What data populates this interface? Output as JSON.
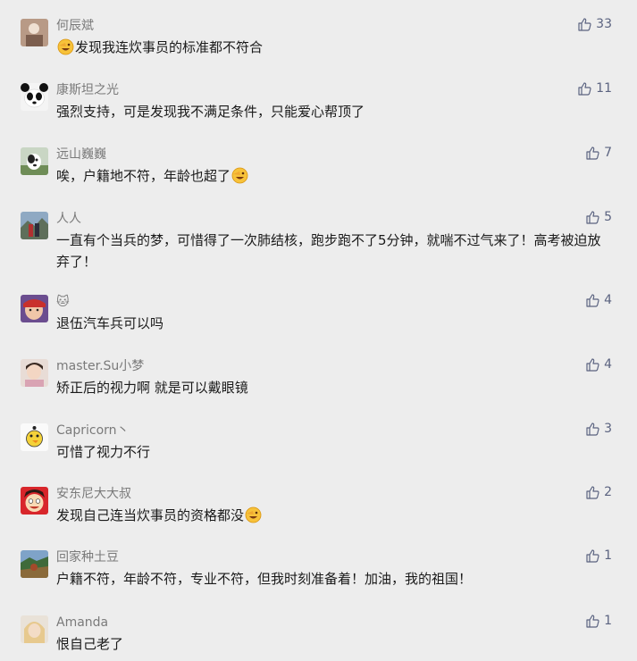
{
  "comments": [
    {
      "name": "何辰斌",
      "text": "发现我连炊事员的标准都不符合",
      "emoji_pos": "start",
      "likes": "33"
    },
    {
      "name": "康斯坦之光",
      "text": "强烈支持，可是发现我不满足条件，只能爱心帮顶了",
      "emoji_pos": "none",
      "likes": "11"
    },
    {
      "name": "远山巍巍",
      "text": "唉，户籍地不符，年龄也超了",
      "emoji_pos": "end",
      "likes": "7"
    },
    {
      "name": "人人",
      "text": "一直有个当兵的梦，可惜得了一次肺结核，跑步跑不了5分钟，就喘不过气来了！高考被迫放弃了！",
      "emoji_pos": "none",
      "likes": "5"
    },
    {
      "name": "🐱",
      "text": "退伍汽车兵可以吗",
      "emoji_pos": "none",
      "likes": "4"
    },
    {
      "name": "master.Su小梦",
      "text": "矫正后的视力啊 就是可以戴眼镜",
      "emoji_pos": "none",
      "likes": "4"
    },
    {
      "name": "Capricorn丶",
      "text": "可惜了视力不行",
      "emoji_pos": "none",
      "likes": "3"
    },
    {
      "name": "安东尼大大叔",
      "text": "发现自己连当炊事员的资格都没",
      "emoji_pos": "end",
      "likes": "2"
    },
    {
      "name": "回家种土豆",
      "text": "户籍不符，年龄不符，专业不符，但我时刻准备着！加油，我的祖国！",
      "emoji_pos": "none",
      "likes": "1"
    },
    {
      "name": "Amanda",
      "text": "恨自己老了",
      "emoji_pos": "none",
      "likes": "1"
    }
  ],
  "avatars": [
    "brown-portrait",
    "panda",
    "dog",
    "couple-mountain",
    "child-red",
    "girl-photo",
    "cartoon-duck",
    "cartoon-boy-red",
    "landscape",
    "blonde-girl"
  ],
  "emoji_name": "facepalm-laugh-emoji",
  "colors": {
    "background": "#ededed",
    "name": "#7a7a7a",
    "text": "#1a1a1a",
    "like": "#5b6380"
  }
}
